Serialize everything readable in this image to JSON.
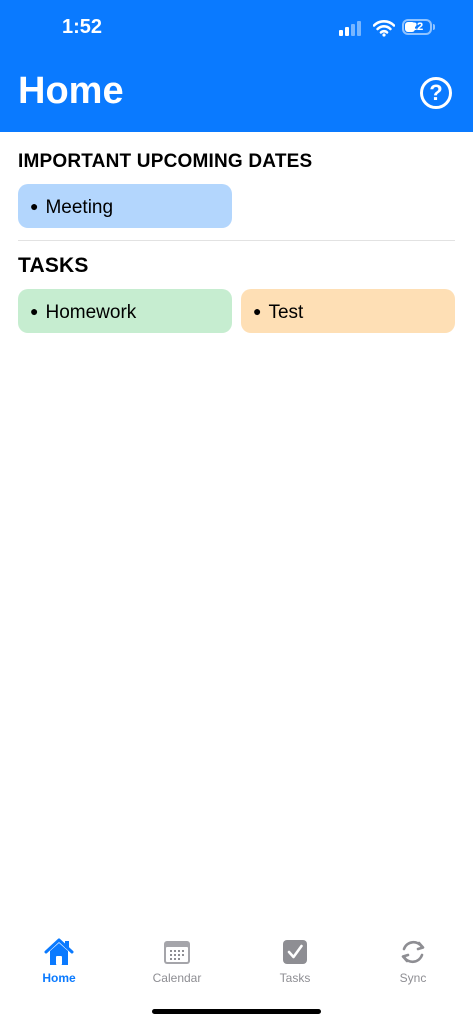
{
  "status_bar": {
    "time": "1:52",
    "battery": "22"
  },
  "header": {
    "title": "Home",
    "help_symbol": "?"
  },
  "important_dates": {
    "title": "IMPORTANT UPCOMING DATES",
    "items": [
      {
        "label": "Meeting",
        "color": "#B3D6FD"
      }
    ]
  },
  "tasks": {
    "title": "TASKS",
    "items": [
      {
        "label": "Homework",
        "color": "#C6EDD0"
      },
      {
        "label": "Test",
        "color": "#FEDFB5"
      }
    ]
  },
  "tab_bar": {
    "tabs": [
      {
        "label": "Home",
        "icon": "house-icon",
        "active": true
      },
      {
        "label": "Calendar",
        "icon": "calendar-icon",
        "active": false
      },
      {
        "label": "Tasks",
        "icon": "checkbox-icon",
        "active": false
      },
      {
        "label": "Sync",
        "icon": "sync-icon",
        "active": false
      }
    ]
  },
  "colors": {
    "accent": "#0A7AFF",
    "inactive": "#8E8E93"
  }
}
